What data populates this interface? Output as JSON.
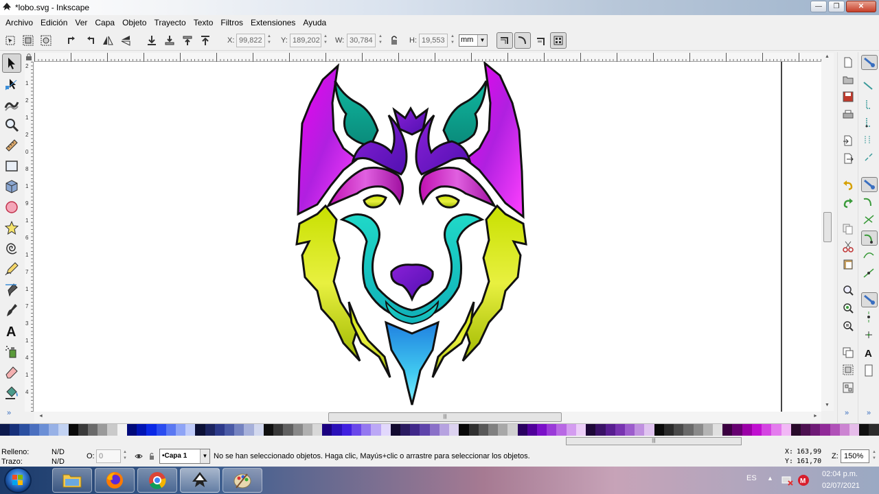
{
  "window": {
    "title": "*lobo.svg - Inkscape",
    "buttons": [
      "—",
      "❐",
      "✕"
    ]
  },
  "menu": [
    "Archivo",
    "Edición",
    "Ver",
    "Capa",
    "Objeto",
    "Trayecto",
    "Texto",
    "Filtros",
    "Extensiones",
    "Ayuda"
  ],
  "controls": {
    "x_label": "X:",
    "x_value": "99,822",
    "y_label": "Y:",
    "y_value": "189,202",
    "w_label": "W:",
    "w_value": "30,784",
    "h_label": "H:",
    "h_value": "19,553",
    "unit": "mm"
  },
  "tools": [
    "selector-tool",
    "node-tool",
    "tweak-tool",
    "zoom-tool",
    "measure-tool",
    "rectangle-tool",
    "3d-box-tool",
    "ellipse-tool",
    "star-tool",
    "spiral-tool",
    "pencil-tool",
    "pen-tool",
    "calligraphy-tool",
    "text-tool",
    "spray-tool",
    "eraser-tool",
    "paint-bucket-tool"
  ],
  "ruler_left_labels": [
    "2",
    "1",
    "2",
    "1",
    "2",
    "0",
    "8",
    "1",
    "9",
    "1",
    "6",
    "1",
    "7",
    "1",
    "7",
    "3",
    "1",
    "4",
    "1",
    "4"
  ],
  "palette": [
    "#0d1a4d",
    "#16307a",
    "#2a4fa0",
    "#4a6fbf",
    "#6b8fd6",
    "#97b1e6",
    "#c2d2f2",
    "#0a0a0a",
    "#3a3a3a",
    "#6a6a6a",
    "#9a9a9a",
    "#cacaca",
    "#f2f2f2",
    "#000a7a",
    "#0014b4",
    "#0a28e6",
    "#2a4cf0",
    "#5a78f2",
    "#8ea4f6",
    "#c0ccfa",
    "#0c1036",
    "#1c2460",
    "#2d3a8a",
    "#4a5aa6",
    "#7482c0",
    "#a6b0da",
    "#d2d8ee",
    "#101010",
    "#383838",
    "#606060",
    "#888888",
    "#b0b0b0",
    "#d8d8d8",
    "#1a0080",
    "#2a10b8",
    "#4020e0",
    "#6a48ea",
    "#9478f0",
    "#bca8f6",
    "#e2d8fc",
    "#120a30",
    "#2a1a60",
    "#40288a",
    "#5e44aa",
    "#8a70c8",
    "#b6a2e0",
    "#dcd2f0",
    "#080808",
    "#303030",
    "#585858",
    "#808080",
    "#a8a8a8",
    "#d0d0d0",
    "#2a0060",
    "#50009a",
    "#7a10c8",
    "#9a3ad8",
    "#b868e4",
    "#d49cf0",
    "#eccef8",
    "#1e0838",
    "#3a1266",
    "#581e90",
    "#7834b0",
    "#9c5ccc",
    "#c090e0",
    "#e0c4f0",
    "#0a0a0a",
    "#2a2a2a",
    "#4a4a4a",
    "#6a6a6a",
    "#8a8a8a",
    "#b4b4b4",
    "#e0e0e0",
    "#3a0040",
    "#660070",
    "#9a00a6",
    "#c010d0",
    "#d444e2",
    "#e47cee",
    "#f2b8f6",
    "#280a2a",
    "#4c1050",
    "#6e1a76",
    "#902a98",
    "#b050b8",
    "#cc84d2",
    "#e6bcea",
    "#101010",
    "#2c2c2c"
  ],
  "status": {
    "fill_label": "Relleno:",
    "fill_value": "N/D",
    "stroke_label": "Trazo:",
    "stroke_value": "N/D",
    "opacity_label": "O:",
    "opacity_value": "0",
    "layer": "•Capa 1",
    "message": "No se han seleccionado objetos. Haga clic, Mayús+clic o arrastre para seleccionar los objetos.",
    "cursor_x_label": "X:",
    "cursor_x": "163,99",
    "cursor_y_label": "Y:",
    "cursor_y": "161,70",
    "zoom_label": "Z:",
    "zoom": "150%"
  },
  "taskbar": {
    "apps": [
      "explorer",
      "firefox",
      "chrome",
      "inkscape",
      "paint"
    ],
    "language": "ES",
    "time": "02:04 p.m.",
    "date": "02/07/2021"
  }
}
